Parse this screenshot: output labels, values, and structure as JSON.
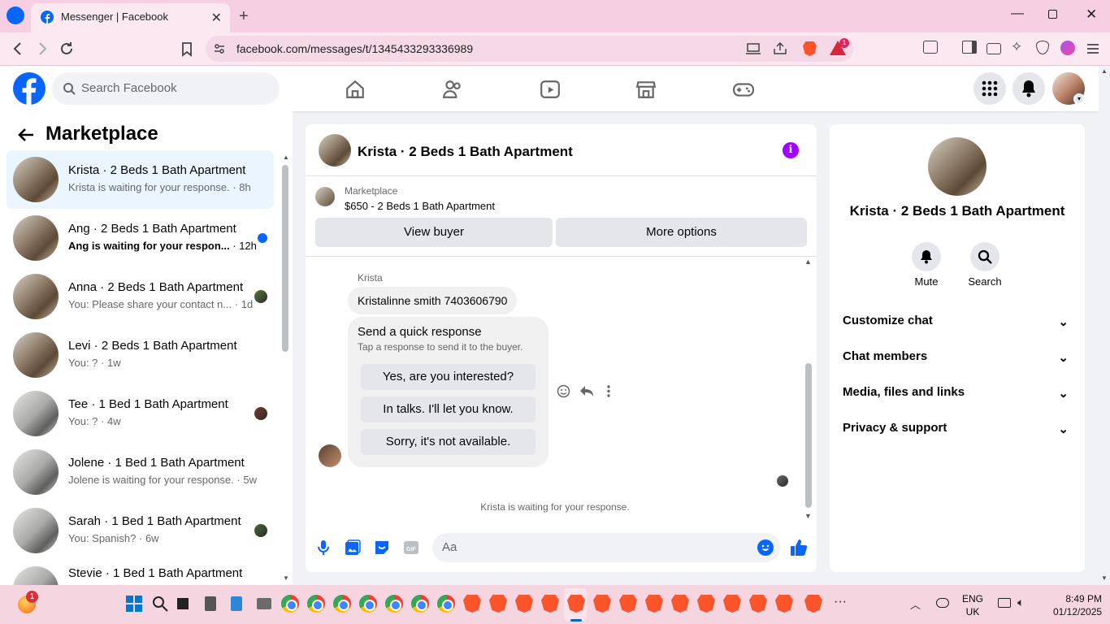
{
  "browser": {
    "tab_title": "Messenger | Facebook",
    "url": "facebook.com/messages/t/1345433293336989",
    "brave_rewards_badge": "1"
  },
  "fb_header": {
    "search_placeholder": "Search Facebook"
  },
  "sidebar": {
    "title": "Marketplace",
    "conversations": [
      {
        "name": "Krista · 2 Beds 1 Bath Apartment",
        "preview": "Krista is waiting for your response.",
        "time": "8h",
        "selected": true
      },
      {
        "name": "Ang · 2 Beds 1 Bath Apartment",
        "preview": "Ang is waiting for your respon...",
        "time": "12h",
        "unread": true
      },
      {
        "name": "Anna · 2 Beds 1 Bath Apartment",
        "preview": "You: Please share your contact n...",
        "time": "1d"
      },
      {
        "name": "Levi · 2 Beds 1 Bath Apartment",
        "preview": "You: ?",
        "time": "1w"
      },
      {
        "name": "Tee · 1 Bed 1 Bath Apartment",
        "preview": "You: ?",
        "time": "4w"
      },
      {
        "name": "Jolene · 1 Bed 1 Bath Apartment",
        "preview": "Jolene is waiting for your response.",
        "time": "5w"
      },
      {
        "name": "Sarah · 1 Bed 1 Bath Apartment",
        "preview": "You: Spanish?",
        "time": "6w"
      },
      {
        "name": "Stevie · 1 Bed 1 Bath Apartment",
        "preview": "",
        "time": ""
      }
    ]
  },
  "chat": {
    "title": "Krista · 2 Beds 1 Bath Apartment",
    "listing_source": "Marketplace",
    "listing_title": "$650 - 2 Beds 1 Bath Apartment",
    "view_buyer_label": "View buyer",
    "more_options_label": "More options",
    "sender_name": "Krista",
    "message": "Kristalinne smith 7403606790",
    "quick_response_title": "Send a quick response",
    "quick_response_subtitle": "Tap a response to send it to the buyer.",
    "quick_responses": [
      "Yes, are you interested?",
      "In talks. I'll let you know.",
      "Sorry, it's not available."
    ],
    "waiting_text": "Krista is waiting for your response.",
    "composer_placeholder": "Aa"
  },
  "info_panel": {
    "name": "Krista · 2 Beds 1 Bath Apartment",
    "mute_label": "Mute",
    "search_label": "Search",
    "sections": [
      "Customize chat",
      "Chat members",
      "Media, files and links",
      "Privacy & support"
    ]
  },
  "taskbar": {
    "notification_badge": "1",
    "lang_line1": "ENG",
    "lang_line2": "UK",
    "time": "8:49 PM",
    "date": "01/12/2025"
  },
  "colors": {
    "accent": "#0866ff",
    "info_purple": "#a100ff",
    "tabstrip": "#f7cfe2"
  }
}
